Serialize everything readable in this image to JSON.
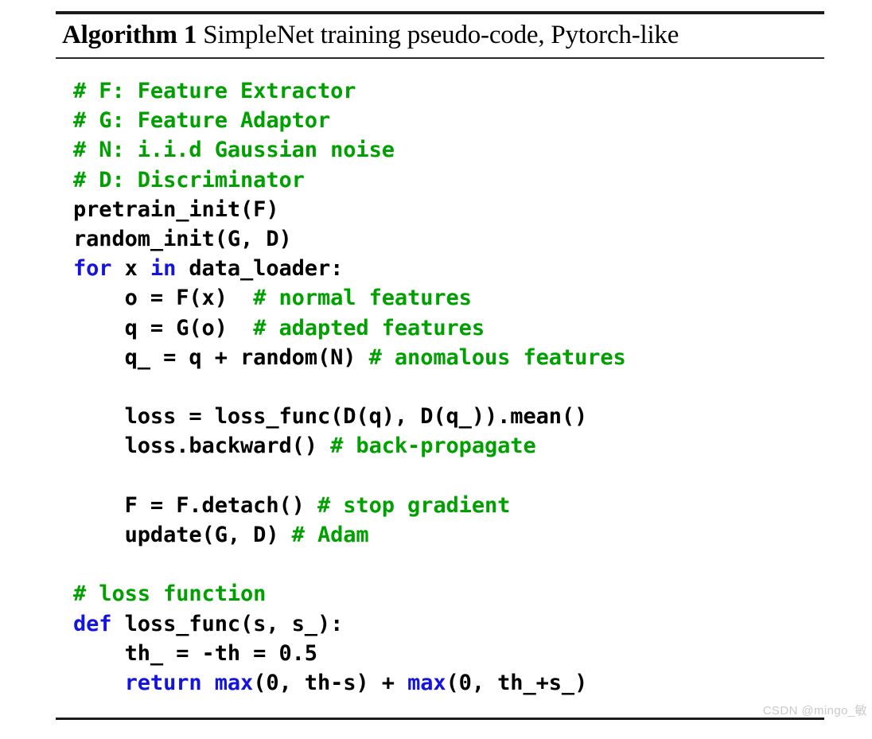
{
  "algorithm": {
    "label": "Algorithm 1",
    "caption": "SimpleNet training pseudo-code, Pytorch-like",
    "colors": {
      "comment": "#00A000",
      "keyword": "#1414DC",
      "plain": "#000000",
      "rule": "#1b1b1b",
      "watermark": "#c9c9c9"
    },
    "code_lines": [
      {
        "id": 1,
        "text": "# F: Feature Extractor",
        "tokens": [
          {
            "t": "# F: Feature Extractor",
            "c": "comment"
          }
        ]
      },
      {
        "id": 2,
        "text": "# G: Feature Adaptor",
        "tokens": [
          {
            "t": "# G: Feature Adaptor",
            "c": "comment"
          }
        ]
      },
      {
        "id": 3,
        "text": "# N: i.i.d Gaussian noise",
        "tokens": [
          {
            "t": "# N: i.i.d Gaussian noise",
            "c": "comment"
          }
        ]
      },
      {
        "id": 4,
        "text": "# D: Discriminator",
        "tokens": [
          {
            "t": "# D: Discriminator",
            "c": "comment"
          }
        ]
      },
      {
        "id": 5,
        "text": "pretrain_init(F)",
        "tokens": [
          {
            "t": "pretrain_init(F)",
            "c": "plain"
          }
        ]
      },
      {
        "id": 6,
        "text": "random_init(G, D)",
        "tokens": [
          {
            "t": "random_init(G, D)",
            "c": "plain"
          }
        ]
      },
      {
        "id": 7,
        "text": "for x in data_loader:",
        "tokens": [
          {
            "t": "for",
            "c": "keyword"
          },
          {
            "t": " x ",
            "c": "plain"
          },
          {
            "t": "in",
            "c": "keyword"
          },
          {
            "t": " data_loader:",
            "c": "plain"
          }
        ]
      },
      {
        "id": 8,
        "text": "    o = F(x)  # normal features",
        "tokens": [
          {
            "t": "    o = F(x)  ",
            "c": "plain"
          },
          {
            "t": "# normal features",
            "c": "comment"
          }
        ]
      },
      {
        "id": 9,
        "text": "    q = G(o)  # adapted features",
        "tokens": [
          {
            "t": "    q = G(o)  ",
            "c": "plain"
          },
          {
            "t": "# adapted features",
            "c": "comment"
          }
        ]
      },
      {
        "id": 10,
        "text": "    q_ = q + random(N) # anomalous features",
        "tokens": [
          {
            "t": "    q_ = q + random(N) ",
            "c": "plain"
          },
          {
            "t": "# anomalous features",
            "c": "comment"
          }
        ]
      },
      {
        "id": 11,
        "text": "",
        "blank": true,
        "tokens": []
      },
      {
        "id": 12,
        "text": "    loss = loss_func(D(q), D(q_)).mean()",
        "tokens": [
          {
            "t": "    loss = loss_func(D(q), D(q_)).mean()",
            "c": "plain"
          }
        ]
      },
      {
        "id": 13,
        "text": "    loss.backward() # back-propagate",
        "tokens": [
          {
            "t": "    loss.backward() ",
            "c": "plain"
          },
          {
            "t": "# back-propagate",
            "c": "comment"
          }
        ]
      },
      {
        "id": 14,
        "text": "",
        "blank": true,
        "tokens": []
      },
      {
        "id": 15,
        "text": "    F = F.detach() # stop gradient",
        "tokens": [
          {
            "t": "    F = F.detach() ",
            "c": "plain"
          },
          {
            "t": "# stop gradient",
            "c": "comment"
          }
        ]
      },
      {
        "id": 16,
        "text": "    update(G, D) # Adam",
        "tokens": [
          {
            "t": "    update(G, D) ",
            "c": "plain"
          },
          {
            "t": "# Adam",
            "c": "comment"
          }
        ]
      },
      {
        "id": 17,
        "text": "",
        "blank": true,
        "tokens": []
      },
      {
        "id": 18,
        "text": "# loss function",
        "tokens": [
          {
            "t": "# loss function",
            "c": "comment"
          }
        ]
      },
      {
        "id": 19,
        "text": "def loss_func(s, s_):",
        "tokens": [
          {
            "t": "def",
            "c": "keyword"
          },
          {
            "t": " loss_func(s, s_):",
            "c": "plain"
          }
        ]
      },
      {
        "id": 20,
        "text": "    th_ = -th = 0.5",
        "tokens": [
          {
            "t": "    th_ = -th = 0.5",
            "c": "plain"
          }
        ]
      },
      {
        "id": 21,
        "text": "    return max(0, th-s) + max(0, th_+s_)",
        "tokens": [
          {
            "t": "    ",
            "c": "plain"
          },
          {
            "t": "return",
            "c": "keyword"
          },
          {
            "t": " ",
            "c": "plain"
          },
          {
            "t": "max",
            "c": "keyword"
          },
          {
            "t": "(0, th-s) + ",
            "c": "plain"
          },
          {
            "t": "max",
            "c": "keyword"
          },
          {
            "t": "(0, th_+s_)",
            "c": "plain"
          }
        ]
      }
    ]
  },
  "watermark": {
    "text": "CSDN @mingo_敏"
  }
}
